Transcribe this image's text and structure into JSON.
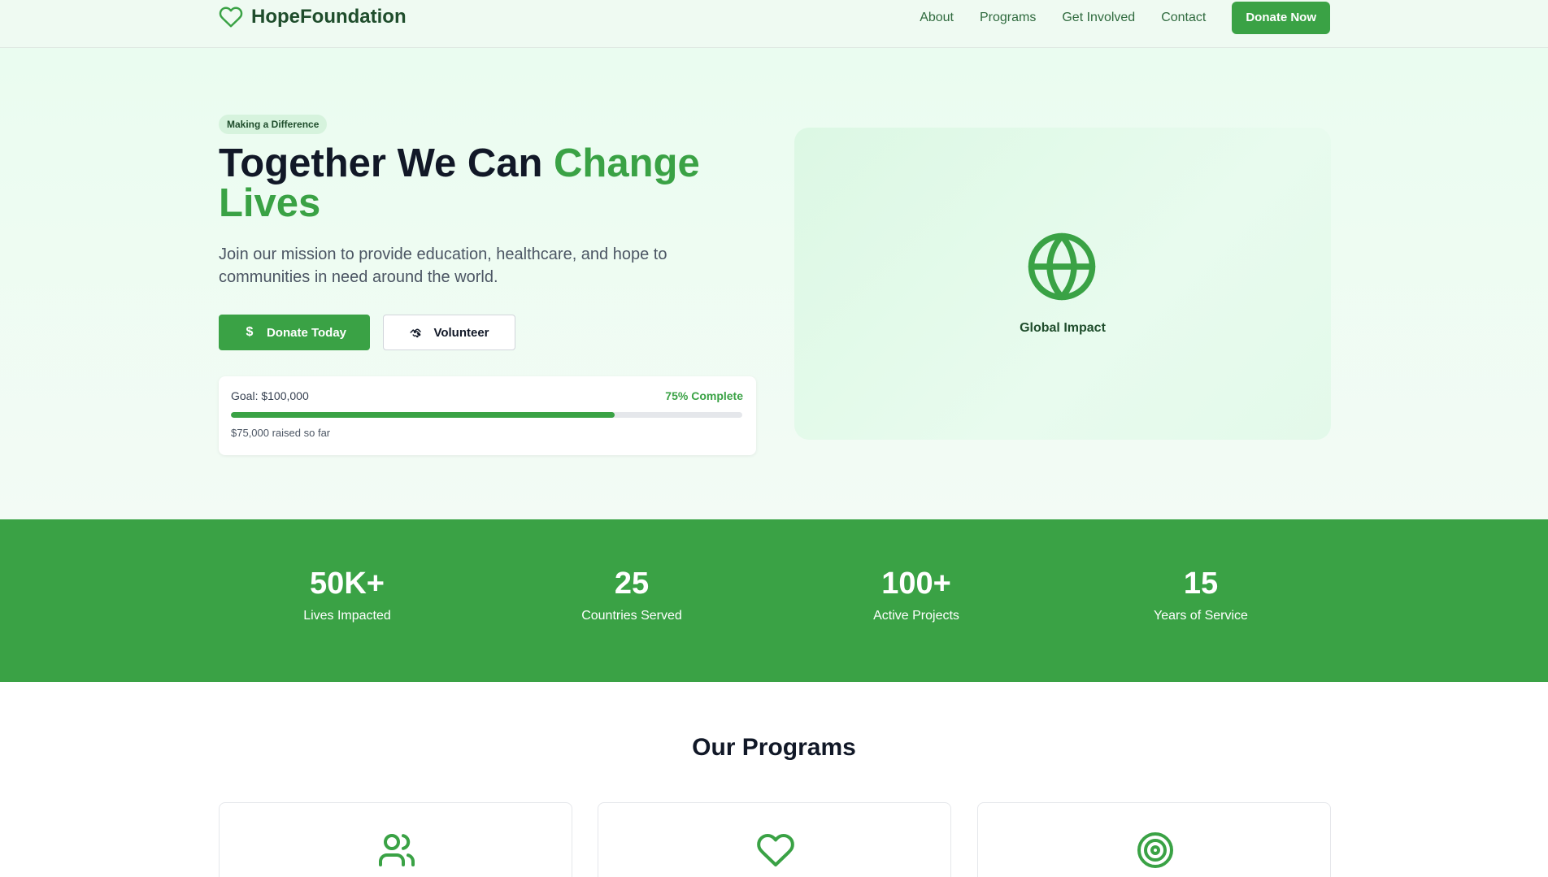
{
  "header": {
    "brand": "HopeFoundation",
    "nav": [
      "About",
      "Programs",
      "Get Involved",
      "Contact"
    ],
    "cta": "Donate Now"
  },
  "hero": {
    "badge": "Making a Difference",
    "title_main": "Together We Can ",
    "title_accent": "Change Lives",
    "subtitle": "Join our mission to provide education, healthcare, and hope to communities in need around the world.",
    "donate_button": "Donate Today",
    "volunteer_button": "Volunteer",
    "progress": {
      "goal": "Goal: $100,000",
      "complete": "75% Complete",
      "raised": "$75,000 raised so far",
      "percent": 75
    },
    "impact_label": "Global Impact"
  },
  "stats": [
    {
      "value": "50K+",
      "label": "Lives Impacted"
    },
    {
      "value": "25",
      "label": "Countries Served"
    },
    {
      "value": "100+",
      "label": "Active Projects"
    },
    {
      "value": "15",
      "label": "Years of Service"
    }
  ],
  "programs": {
    "title": "Our Programs",
    "icons": [
      "users-icon",
      "heart-icon",
      "target-icon"
    ]
  },
  "colors": {
    "accent": "#3aa245",
    "brand_dark": "#1f4d2c",
    "hero_bg": "#eafcf0"
  }
}
